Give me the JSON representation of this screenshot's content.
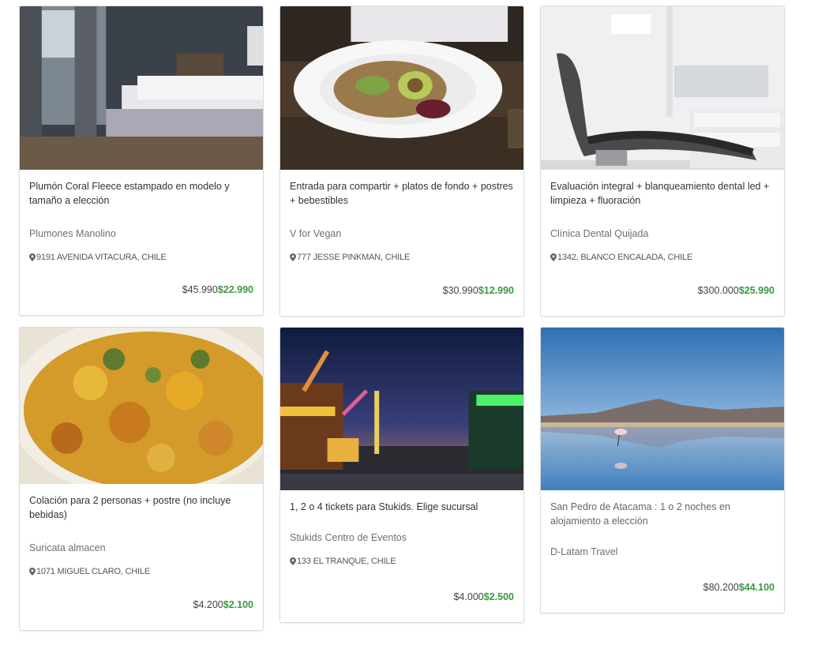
{
  "cards": [
    {
      "title": "Plumón Coral Fleece estampado en modelo y tamaño a elección",
      "merchant": "Plumones Manolino",
      "address": "9191 AVENIDA VITACURA, CHILE",
      "price_old": "$45.990",
      "price_new": "$22.990",
      "image": "bedroom-photo"
    },
    {
      "title": "Entrada para compartir + platos de fondo + postres + bebestibles",
      "merchant": "V for Vegan",
      "address": "777 JESSE PINKMAN, CHILE",
      "price_old": "$30.990",
      "price_new": "$12.990",
      "image": "vegan-plate-photo"
    },
    {
      "title": "Evaluación integral + blanqueamiento dental led + limpieza + fluoración",
      "merchant": "Clínica Dental Quijada",
      "address": "1342, BLANCO ENCALADA, CHILE",
      "price_old": "$300.000",
      "price_new": "$25.990",
      "image": "dental-chair-photo"
    },
    {
      "title": "Colación para 2 personas + postre (no incluye bebidas)",
      "merchant": "Suricata almacen",
      "address": "1071 MIGUEL CLARO, CHILE",
      "price_old": "$4.200",
      "price_new": "$2.100",
      "image": "food-bowl-photo"
    },
    {
      "title": "1, 2 o 4 tickets para Stukids. Elige sucursal",
      "merchant": "Stukids Centro de Eventos",
      "address": "133 EL TRANQUE, CHILE",
      "price_old": "$4.000",
      "price_new": "$2.500",
      "image": "fair-night-photo"
    },
    {
      "title": "San Pedro de Atacama : 1 o 2 noches en alojamiento a elección",
      "merchant": "D-Latam Travel",
      "price_old": "$80.200",
      "price_new": "$44.100",
      "image": "flamingo-lake-photo"
    }
  ],
  "colors": {
    "price_new": "#3a9a3f",
    "border": "#dcdcdc"
  }
}
